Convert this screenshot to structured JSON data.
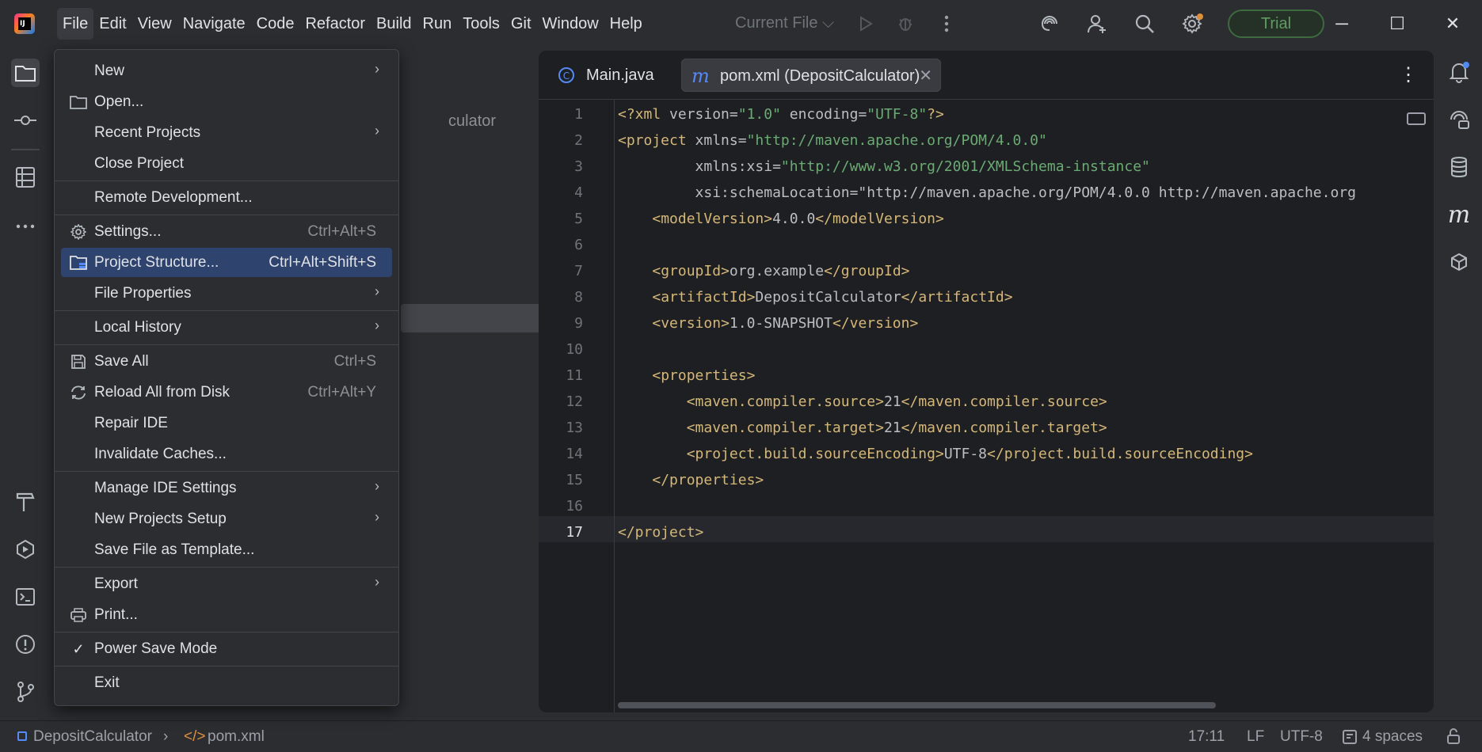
{
  "menubar": {
    "items": [
      "File",
      "Edit",
      "View",
      "Navigate",
      "Code",
      "Refactor",
      "Build",
      "Run",
      "Tools",
      "Git",
      "Window",
      "Help"
    ]
  },
  "toolbar": {
    "run_config": "Current File ⌵",
    "trial_label": "Trial"
  },
  "project_panel": {
    "ghost_text": "culator"
  },
  "file_menu": {
    "items": [
      {
        "label": "New",
        "shortcut": "",
        "submenu": true,
        "icon": ""
      },
      {
        "label": "Open...",
        "shortcut": "",
        "submenu": false,
        "icon": "folder-icon"
      },
      {
        "label": "Recent Projects",
        "shortcut": "",
        "submenu": true,
        "icon": ""
      },
      {
        "label": "Close Project",
        "shortcut": "",
        "submenu": false,
        "icon": ""
      },
      {
        "label": "Remote Development...",
        "shortcut": "",
        "submenu": false,
        "icon": ""
      },
      {
        "label": "Settings...",
        "shortcut": "Ctrl+Alt+S",
        "submenu": false,
        "icon": "gear-icon"
      },
      {
        "label": "Project Structure...",
        "shortcut": "Ctrl+Alt+Shift+S",
        "submenu": false,
        "icon": "project-structure-icon",
        "selected": true
      },
      {
        "label": "File Properties",
        "shortcut": "",
        "submenu": true,
        "icon": ""
      },
      {
        "label": "Local History",
        "shortcut": "",
        "submenu": true,
        "icon": ""
      },
      {
        "label": "Save All",
        "shortcut": "Ctrl+S",
        "submenu": false,
        "icon": "save-icon"
      },
      {
        "label": "Reload All from Disk",
        "shortcut": "Ctrl+Alt+Y",
        "submenu": false,
        "icon": "reload-icon"
      },
      {
        "label": "Repair IDE",
        "shortcut": "",
        "submenu": false,
        "icon": ""
      },
      {
        "label": "Invalidate Caches...",
        "shortcut": "",
        "submenu": false,
        "icon": ""
      },
      {
        "label": "Manage IDE Settings",
        "shortcut": "",
        "submenu": true,
        "icon": ""
      },
      {
        "label": "New Projects Setup",
        "shortcut": "",
        "submenu": true,
        "icon": ""
      },
      {
        "label": "Save File as Template...",
        "shortcut": "",
        "submenu": false,
        "icon": ""
      },
      {
        "label": "Export",
        "shortcut": "",
        "submenu": true,
        "icon": ""
      },
      {
        "label": "Print...",
        "shortcut": "",
        "submenu": false,
        "icon": "print-icon"
      },
      {
        "label": "Power Save Mode",
        "shortcut": "",
        "submenu": false,
        "icon": "check-icon"
      },
      {
        "label": "Exit",
        "shortcut": "",
        "submenu": false,
        "icon": ""
      }
    ]
  },
  "editor": {
    "tabs": [
      {
        "label": "Main.java",
        "icon": "java-class-icon",
        "active": false
      },
      {
        "label": "pom.xml (DepositCalculator)",
        "icon": "maven-icon",
        "active": true
      }
    ],
    "current_line": 17,
    "lines": [
      "<?xml version=\"1.0\" encoding=\"UTF-8\"?>",
      "<project xmlns=\"http://maven.apache.org/POM/4.0.0\"",
      "         xmlns:xsi=\"http://www.w3.org/2001/XMLSchema-instance\"",
      "         xsi:schemaLocation=\"http://maven.apache.org/POM/4.0.0 http://maven.apache.org",
      "    <modelVersion>4.0.0</modelVersion>",
      "",
      "    <groupId>org.example</groupId>",
      "    <artifactId>DepositCalculator</artifactId>",
      "    <version>1.0-SNAPSHOT</version>",
      "",
      "    <properties>",
      "        <maven.compiler.source>21</maven.compiler.source>",
      "        <maven.compiler.target>21</maven.compiler.target>",
      "        <project.build.sourceEncoding>UTF-8</project.build.sourceEncoding>",
      "    </properties>",
      "",
      "</project>"
    ]
  },
  "statusbar": {
    "project": "DepositCalculator",
    "file": "pom.xml",
    "caret": "17:11",
    "line_sep": "LF",
    "encoding": "UTF-8",
    "indent": "4 spaces"
  }
}
